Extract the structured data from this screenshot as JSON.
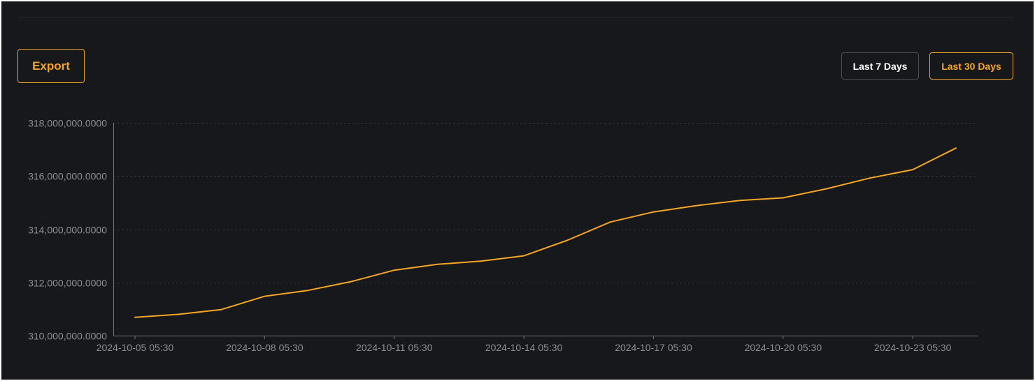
{
  "toolbar": {
    "export_label": "Export",
    "range_options": [
      {
        "label": "Last 7 Days",
        "selected": false
      },
      {
        "label": "Last 30 Days",
        "selected": true
      }
    ]
  },
  "colors": {
    "accent": "#f5a623",
    "background": "#17181c",
    "grid": "#34363c",
    "tick_text": "#8c8f96"
  },
  "chart_data": {
    "type": "line",
    "title": "",
    "xlabel": "",
    "ylabel": "",
    "grid": true,
    "legend": "none",
    "ylim": [
      310000000,
      318000000
    ],
    "yticks": [
      310000000,
      312000000,
      314000000,
      316000000,
      318000000
    ],
    "ytick_labels": [
      "310,000,000.0000",
      "312,000,000.0000",
      "314,000,000.0000",
      "316,000,000.0000",
      "318,000,000.0000"
    ],
    "xlim": [
      "2024-10-04 17:30",
      "2024-10-24 17:30"
    ],
    "xticks": [
      "2024-10-05 05:30",
      "2024-10-08 05:30",
      "2024-10-11 05:30",
      "2024-10-14 05:30",
      "2024-10-17 05:30",
      "2024-10-20 05:30",
      "2024-10-23 05:30"
    ],
    "xtick_labels": [
      "2024-10-05 05:30",
      "2024-10-08 05:30",
      "2024-10-11 05:30",
      "2024-10-14 05:30",
      "2024-10-17 05:30",
      "2024-10-20 05:30",
      "2024-10-23 05:30"
    ],
    "series": [
      {
        "color": "#f5a623",
        "x": [
          "2024-10-05 05:30",
          "2024-10-06 05:30",
          "2024-10-07 05:30",
          "2024-10-08 05:30",
          "2024-10-09 05:30",
          "2024-10-10 05:30",
          "2024-10-11 05:30",
          "2024-10-12 05:30",
          "2024-10-13 05:30",
          "2024-10-14 05:30",
          "2024-10-15 05:30",
          "2024-10-16 05:30",
          "2024-10-17 05:30",
          "2024-10-18 05:30",
          "2024-10-19 05:30",
          "2024-10-20 05:30",
          "2024-10-21 05:30",
          "2024-10-22 05:30",
          "2024-10-23 05:30",
          "2024-10-24 05:30"
        ],
        "values": [
          310690000,
          310800000,
          310980000,
          311480000,
          311700000,
          312030000,
          312460000,
          312680000,
          312800000,
          313000000,
          313580000,
          314270000,
          314650000,
          314890000,
          315080000,
          315180000,
          315520000,
          315920000,
          316240000,
          317050000
        ]
      }
    ]
  }
}
